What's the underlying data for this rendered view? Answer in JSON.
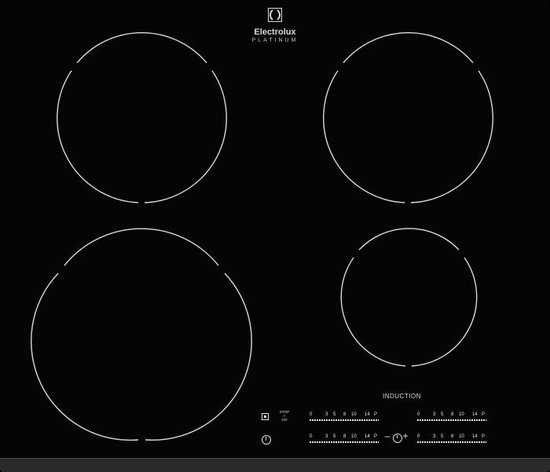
{
  "branding": {
    "brand": "Electrolux",
    "series": "PLATINUM",
    "logo_icon": "electrolux-logo-icon"
  },
  "panel_label": "INDUCTION",
  "controls": {
    "stop_go": {
      "line1": "STOP",
      "line2": "+",
      "line3": "GO"
    },
    "lock_icon": "lock-icon",
    "power_icon": "power-icon",
    "timer_icon": "timer-icon",
    "minus_label": "–",
    "plus_label": "+",
    "sliders": [
      {
        "ticks": [
          "0",
          "3",
          "5",
          "8",
          "10",
          "14",
          "P"
        ]
      },
      {
        "ticks": [
          "0",
          "3",
          "5",
          "8",
          "10",
          "14",
          "P"
        ]
      },
      {
        "ticks": [
          "0",
          "3",
          "5",
          "8",
          "10",
          "14",
          "P"
        ]
      },
      {
        "ticks": [
          "0",
          "3",
          "5",
          "8",
          "10",
          "14",
          "P"
        ]
      }
    ]
  },
  "colors": {
    "glass": "#050505",
    "markings": "#e0e0e0",
    "edge": "#2a2a2a"
  }
}
